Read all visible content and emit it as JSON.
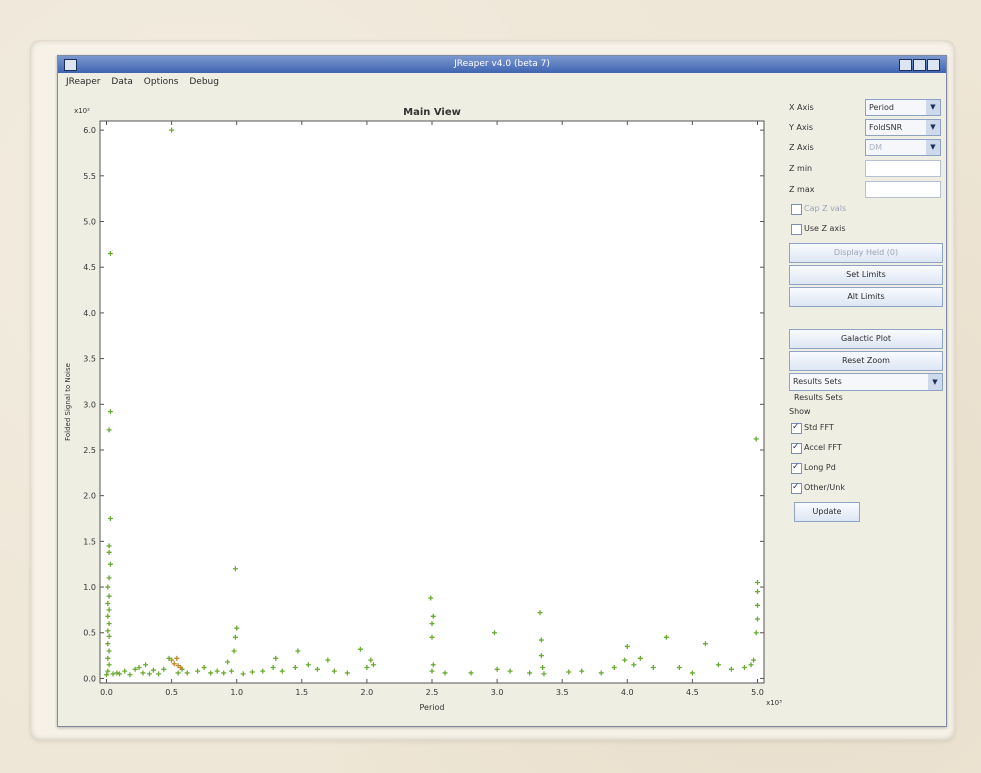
{
  "window": {
    "title": "JReaper v4.0 (beta 7)",
    "menu": [
      "JReaper",
      "Data",
      "Options",
      "Debug"
    ]
  },
  "main_view": {
    "title": "Main View",
    "xlabel": "Period",
    "ylabel": "Folded Signal to Noise",
    "x_exponent": "x10³",
    "y_exponent": "x10²"
  },
  "controls": {
    "x_axis_label": "X Axis",
    "x_axis_value": "Period",
    "y_axis_label": "Y Axis",
    "y_axis_value": "FoldSNR",
    "z_axis_label": "Z Axis",
    "z_axis_value": "DM",
    "z_min_label": "Z min",
    "z_max_label": "Z max",
    "cap_z_label": "Cap Z vals",
    "use_z_label": "Use Z axis",
    "display_held_label": "Display Held (0)",
    "set_limits_label": "Set Limits",
    "all_limits_label": "Alt Limits",
    "galactic_plot_label": "Galactic Plot",
    "reset_zoom_label": "Reset Zoom",
    "results_sets_select": "Results Sets",
    "results_sets_title": "Results Sets",
    "show_label": "Show",
    "std_fft_label": "Std FFT",
    "accel_fft_label": "Accel FFT",
    "long_pd_label": "Long Pd",
    "other_unk_label": "Other/Unk",
    "update_label": "Update"
  },
  "chart_data": {
    "type": "scatter",
    "title": "Main View",
    "xlabel": "Period",
    "ylabel": "Folded Signal to Noise",
    "x_tick_labels": [
      "0.0",
      "0.5",
      "1.0",
      "1.5",
      "2.0",
      "2.5",
      "3.0",
      "3.5",
      "4.0",
      "4.5",
      "5.0"
    ],
    "y_tick_labels": [
      "0.0",
      "0.5",
      "1.0",
      "1.5",
      "2.0",
      "2.5",
      "3.0",
      "3.5",
      "4.0",
      "4.5",
      "5.0",
      "5.5",
      "6.0"
    ],
    "x_multiplier": "x10³",
    "y_multiplier": "x10²",
    "xlim": [
      -0.05,
      5.05
    ],
    "ylim": [
      -0.05,
      6.1
    ],
    "marker_color": "#6aaa33",
    "highlight_color": "#c08a2a",
    "series": [
      {
        "values": [
          [
            0.0,
            0.04
          ],
          [
            0.01,
            0.08
          ],
          [
            0.02,
            0.15
          ],
          [
            0.01,
            0.22
          ],
          [
            0.02,
            0.3
          ],
          [
            0.01,
            0.38
          ],
          [
            0.02,
            0.46
          ],
          [
            0.01,
            0.52
          ],
          [
            0.02,
            0.6
          ],
          [
            0.01,
            0.68
          ],
          [
            0.02,
            0.75
          ],
          [
            0.01,
            0.82
          ],
          [
            0.02,
            0.9
          ],
          [
            0.01,
            1.0
          ],
          [
            0.02,
            1.1
          ],
          [
            0.03,
            1.25
          ],
          [
            0.02,
            1.38
          ],
          [
            0.02,
            1.45
          ],
          [
            0.03,
            1.75
          ],
          [
            0.02,
            2.72
          ],
          [
            0.03,
            2.92
          ],
          [
            0.03,
            4.65
          ],
          [
            0.05,
            0.05
          ],
          [
            0.08,
            0.06
          ],
          [
            0.1,
            0.05
          ],
          [
            0.14,
            0.08
          ],
          [
            0.18,
            0.04
          ],
          [
            0.22,
            0.1
          ],
          [
            0.25,
            0.12
          ],
          [
            0.28,
            0.06
          ],
          [
            0.3,
            0.15
          ],
          [
            0.33,
            0.05
          ],
          [
            0.36,
            0.09
          ],
          [
            0.4,
            0.05
          ],
          [
            0.44,
            0.1
          ],
          [
            0.48,
            0.22
          ],
          [
            0.5,
            6.0
          ],
          [
            0.55,
            0.06
          ],
          [
            0.58,
            0.1
          ],
          [
            0.62,
            0.06
          ],
          [
            0.7,
            0.08
          ],
          [
            0.75,
            0.12
          ],
          [
            0.8,
            0.06
          ],
          [
            0.85,
            0.08
          ],
          [
            0.9,
            0.06
          ],
          [
            0.93,
            0.18
          ],
          [
            0.96,
            0.08
          ],
          [
            0.98,
            0.3
          ],
          [
            0.99,
            0.45
          ],
          [
            1.0,
            0.55
          ],
          [
            0.99,
            1.2
          ],
          [
            1.05,
            0.05
          ],
          [
            1.12,
            0.07
          ],
          [
            1.2,
            0.08
          ],
          [
            1.28,
            0.12
          ],
          [
            1.3,
            0.22
          ],
          [
            1.35,
            0.08
          ],
          [
            1.45,
            0.12
          ],
          [
            1.47,
            0.3
          ],
          [
            1.55,
            0.15
          ],
          [
            1.62,
            0.1
          ],
          [
            1.7,
            0.2
          ],
          [
            1.75,
            0.08
          ],
          [
            1.85,
            0.06
          ],
          [
            1.95,
            0.32
          ],
          [
            2.0,
            0.12
          ],
          [
            2.03,
            0.2
          ],
          [
            2.05,
            0.15
          ],
          [
            2.49,
            0.88
          ],
          [
            2.5,
            0.6
          ],
          [
            2.5,
            0.45
          ],
          [
            2.51,
            0.68
          ],
          [
            2.51,
            0.15
          ],
          [
            2.5,
            0.08
          ],
          [
            2.6,
            0.06
          ],
          [
            2.8,
            0.06
          ],
          [
            2.98,
            0.5
          ],
          [
            3.0,
            0.1
          ],
          [
            3.1,
            0.08
          ],
          [
            3.25,
            0.06
          ],
          [
            3.33,
            0.72
          ],
          [
            3.34,
            0.42
          ],
          [
            3.34,
            0.25
          ],
          [
            3.35,
            0.12
          ],
          [
            3.36,
            0.05
          ],
          [
            3.55,
            0.07
          ],
          [
            3.65,
            0.08
          ],
          [
            3.8,
            0.06
          ],
          [
            3.9,
            0.12
          ],
          [
            3.98,
            0.2
          ],
          [
            4.0,
            0.35
          ],
          [
            4.05,
            0.15
          ],
          [
            4.1,
            0.22
          ],
          [
            4.2,
            0.12
          ],
          [
            4.3,
            0.45
          ],
          [
            4.4,
            0.12
          ],
          [
            4.5,
            0.06
          ],
          [
            4.6,
            0.38
          ],
          [
            4.7,
            0.15
          ],
          [
            4.8,
            0.1
          ],
          [
            4.9,
            0.12
          ],
          [
            4.95,
            0.15
          ],
          [
            4.97,
            0.2
          ],
          [
            4.99,
            0.5
          ],
          [
            5.0,
            0.65
          ],
          [
            5.0,
            0.8
          ],
          [
            5.0,
            0.95
          ],
          [
            5.0,
            1.05
          ],
          [
            4.99,
            2.62
          ]
        ]
      },
      {
        "values": [
          [
            0.5,
            0.2
          ],
          [
            0.52,
            0.16
          ],
          [
            0.55,
            0.14
          ],
          [
            0.54,
            0.22
          ],
          [
            0.57,
            0.12
          ]
        ]
      }
    ]
  }
}
